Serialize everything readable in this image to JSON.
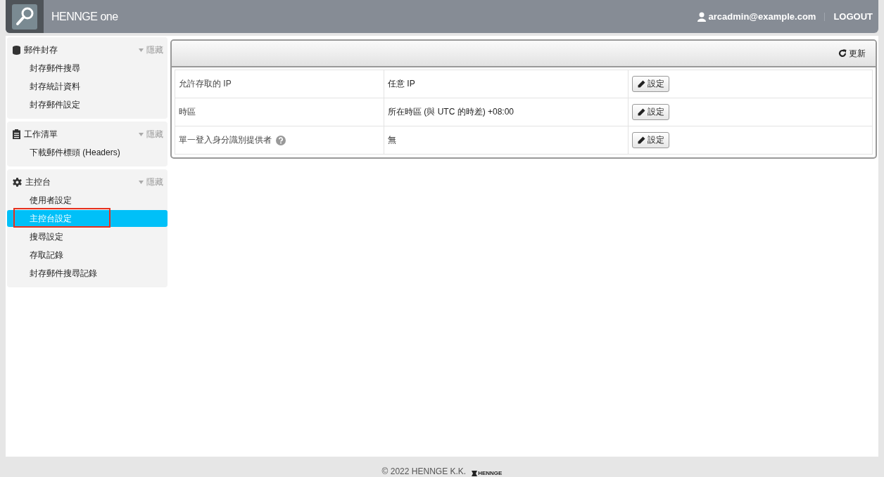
{
  "header": {
    "brand": "HENNGE one",
    "user": "arcadmin@example.com",
    "logout": "LOGOUT"
  },
  "sidebar": {
    "sections": [
      {
        "kind": "archive",
        "title": "郵件封存",
        "hide": "隱藏",
        "items": [
          {
            "label": "封存郵件搜尋",
            "selected": false,
            "highlighted": false
          },
          {
            "label": "封存統計資料",
            "selected": false,
            "highlighted": false
          },
          {
            "label": "封存郵件設定",
            "selected": false,
            "highlighted": false
          }
        ]
      },
      {
        "kind": "tasks",
        "title": "工作清單",
        "hide": "隱藏",
        "items": [
          {
            "label": "下載郵件標頭 (Headers)",
            "selected": false,
            "highlighted": false
          }
        ]
      },
      {
        "kind": "console",
        "title": "主控台",
        "hide": "隱藏",
        "items": [
          {
            "label": "使用者設定",
            "selected": false,
            "highlighted": false
          },
          {
            "label": "主控台設定",
            "selected": true,
            "highlighted": true
          },
          {
            "label": "搜尋設定",
            "selected": false,
            "highlighted": false
          },
          {
            "label": "存取記錄",
            "selected": false,
            "highlighted": false
          },
          {
            "label": "封存郵件搜尋記錄",
            "selected": false,
            "highlighted": false
          }
        ]
      }
    ]
  },
  "toolbar": {
    "refresh": "更新"
  },
  "settings": [
    {
      "name": "允許存取的 IP",
      "help": false,
      "value": "任意 IP",
      "button": "設定"
    },
    {
      "name": "時區",
      "help": false,
      "value": "所在時區 (與 UTC 的時差) +08:00",
      "button": "設定"
    },
    {
      "name": "單一登入身分識別提供者",
      "help": true,
      "value": "無",
      "button": "設定"
    }
  ],
  "footer": {
    "copyright": "© 2022 HENNGE K.K.",
    "logo": "HENNGE"
  }
}
